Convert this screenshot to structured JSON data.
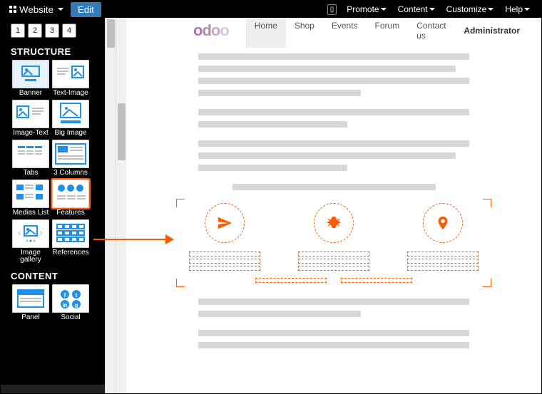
{
  "topbar": {
    "website_label": "Website",
    "edit_label": "Edit",
    "right_menu": [
      "Promote",
      "Content",
      "Customize",
      "Help"
    ]
  },
  "sidebar": {
    "pages": [
      "1",
      "2",
      "3",
      "4"
    ],
    "structure_header": "STRUCTURE",
    "content_header": "CONTENT",
    "structure_blocks": [
      {
        "label": "Banner",
        "selected": false
      },
      {
        "label": "Text-Image",
        "selected": false
      },
      {
        "label": "Image-Text",
        "selected": false
      },
      {
        "label": "Big Image",
        "selected": false
      },
      {
        "label": "Tabs",
        "selected": false
      },
      {
        "label": "3 Columns",
        "selected": false
      },
      {
        "label": "Medias List",
        "selected": false
      },
      {
        "label": "Features",
        "selected": true
      },
      {
        "label": "Image gallery",
        "selected": false
      },
      {
        "label": "References",
        "selected": false
      }
    ],
    "content_blocks": [
      {
        "label": "Panel"
      },
      {
        "label": "Social"
      }
    ]
  },
  "page_header": {
    "brand": "odoo",
    "nav": [
      {
        "label": "Home",
        "active": true
      },
      {
        "label": "Shop",
        "active": false
      },
      {
        "label": "Events",
        "active": false
      },
      {
        "label": "Forum",
        "active": false
      },
      {
        "label": "Contact us",
        "active": false
      }
    ],
    "user_menu": "Administrator"
  },
  "features_block": {
    "icons": [
      "paper-plane",
      "bug",
      "location-pin"
    ]
  },
  "colors": {
    "accent": "#ff5a00",
    "blue": "#1f8fe8"
  }
}
